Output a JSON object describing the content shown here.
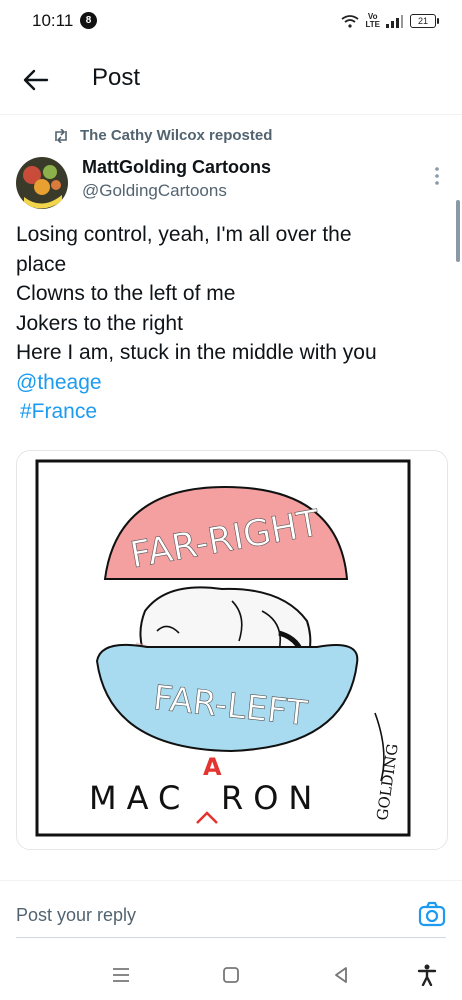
{
  "status_bar": {
    "time": "10:11",
    "notification_badge": "8",
    "network": "LTE",
    "network_prefix": "Vo",
    "battery": "21"
  },
  "header": {
    "title": "Post"
  },
  "post": {
    "repost_label": "The Cathy Wilcox reposted",
    "author_name": "MattGolding Cartoons",
    "author_handle": "@GoldingCartoons",
    "text_lines": [
      "Losing control, yeah, I'm all over the",
      "place",
      "Clowns to the left of me",
      "Jokers to the right",
      "Here I am, stuck in the middle with you"
    ],
    "mention": "@theage",
    "hashtag": "#France"
  },
  "cartoon": {
    "top_bun_text": "FAR-RIGHT",
    "bottom_bun_text": "FAR-LEFT",
    "caption_left": "MAC",
    "caption_inserted": "A",
    "caption_right": "RON",
    "signature": "GOLDING",
    "colors": {
      "top_bun": "#f4a0a0",
      "bottom_bun": "#a8dbf0",
      "insert_mark": "#e3342f"
    }
  },
  "reply": {
    "placeholder": "Post your reply"
  },
  "colors": {
    "link": "#1d9bf0",
    "secondary_text": "#536471"
  }
}
